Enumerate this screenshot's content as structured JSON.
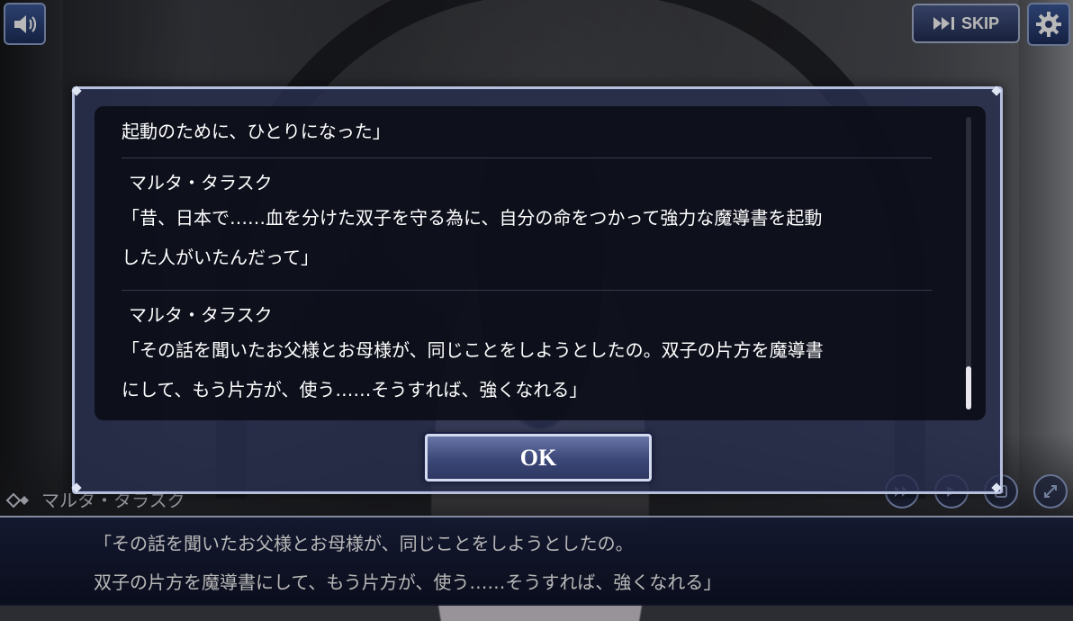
{
  "topbar": {
    "sound_icon": "speaker-icon",
    "skip_label": "SKIP",
    "skip_icon": "fast-forward-icon",
    "settings_icon": "gear-icon"
  },
  "backlog": {
    "entries": [
      {
        "speaker": "",
        "lines": [
          "起動のために、ひとりになった」"
        ]
      },
      {
        "speaker": "マルタ・タラスク",
        "lines": [
          "「昔、日本で……血を分けた双子を守る為に、自分の命をつかって強力な魔導書を起動",
          "した人がいたんだって」"
        ]
      },
      {
        "speaker": "マルタ・タラスク",
        "lines": [
          "「その話を聞いたお父様とお母様が、同じことをしようとしたの。双子の片方を魔導書",
          "にして、もう片方が、使う……そうすれば、強くなれる」"
        ]
      }
    ],
    "ok_label": "OK"
  },
  "message_window": {
    "speaker": "マルタ・タラスク",
    "lines": [
      "「その話を聞いたお父様とお母様が、同じことをしようとしたの。",
      "双子の片方を魔導書にして、もう片方が、使う……そうすれば、強くなれる」"
    ]
  },
  "colors": {
    "frame": "#b6bfdc",
    "panel": "#282e4e",
    "button": "#3b4777"
  }
}
